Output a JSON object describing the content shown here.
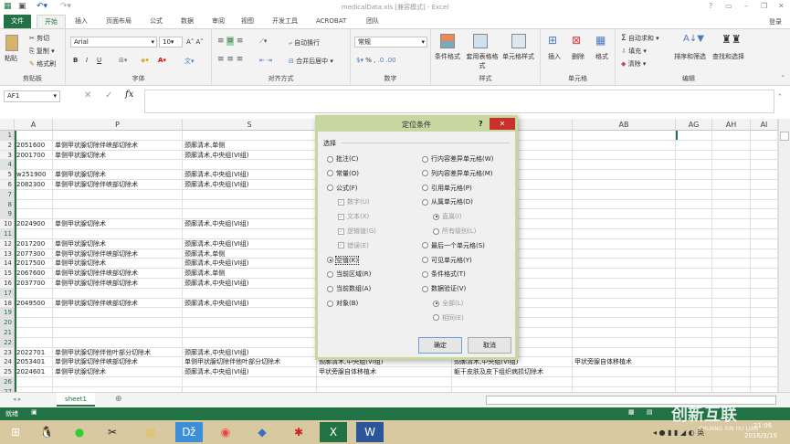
{
  "window": {
    "title": "medicalData.xls [兼容模式] - Excel",
    "help": "?",
    "login": "登录"
  },
  "tabs": [
    "文件",
    "开始",
    "插入",
    "页面布局",
    "公式",
    "数据",
    "审阅",
    "视图",
    "开发工具",
    "ACROBAT",
    "团队"
  ],
  "ribbon": {
    "clipboard": {
      "paste": "粘贴",
      "cut": "剪切",
      "copy": "复制",
      "format_painter": "格式刷",
      "label": "剪贴板"
    },
    "font": {
      "name": "Arial",
      "size": "10",
      "bold": "B",
      "italic": "I",
      "underline": "U",
      "label": "字体"
    },
    "alignment": {
      "wrap": "自动换行",
      "merge": "合并后居中",
      "label": "对齐方式"
    },
    "number": {
      "format": "常规",
      "percent": "%",
      "comma": ",",
      "label": "数字"
    },
    "styles": {
      "conditional": "条件格式",
      "table": "套用表格格式",
      "cell": "单元格样式",
      "label": "样式"
    },
    "cells": {
      "insert": "插入",
      "delete": "删除",
      "format": "格式",
      "label": "单元格"
    },
    "editing": {
      "autosum": "自动求和",
      "fill": "填充",
      "clear": "清除",
      "sort": "排序和筛选",
      "find": "查找和选择",
      "label": "编辑"
    }
  },
  "formula_bar": {
    "name_box": "AF1",
    "fx": "fx",
    "value": ""
  },
  "columns": [
    "A",
    "P",
    "S",
    "",
    "",
    "AB",
    "AG",
    "AH",
    "AI"
  ],
  "rows": [
    {
      "n": "1",
      "c": [
        "",
        "",
        "",
        "",
        "",
        ""
      ]
    },
    {
      "n": "2",
      "c": [
        "2051600",
        "单侧甲状腺切除伴峡部切除术",
        "颈廓清术,单侧",
        "",
        "",
        ""
      ]
    },
    {
      "n": "3",
      "c": [
        "2001700",
        "单侧甲状腺切除术",
        "颈廓清术,中央组(VI组)",
        "",
        "",
        ""
      ]
    },
    {
      "n": "4",
      "c": [
        "",
        "",
        "",
        "",
        "",
        ""
      ]
    },
    {
      "n": "5",
      "c": [
        "w251900",
        "单侧甲状腺切除术",
        "颈廓清术,中央组(VI组)",
        "",
        "",
        ""
      ]
    },
    {
      "n": "6",
      "c": [
        "2082300",
        "单侧甲状腺切除伴峡部切除术",
        "颈廓清术,中央组(VI组)",
        "",
        "",
        ""
      ]
    },
    {
      "n": "7",
      "c": [
        "",
        "",
        "",
        "",
        "",
        ""
      ]
    },
    {
      "n": "8",
      "c": [
        "",
        "",
        "",
        "",
        "",
        ""
      ]
    },
    {
      "n": "9",
      "c": [
        "",
        "",
        "",
        "",
        "",
        ""
      ]
    },
    {
      "n": "10",
      "c": [
        "2024900",
        "单侧甲状腺切除术",
        "颈廓清术,中央组(VI组)",
        "",
        "",
        ""
      ]
    },
    {
      "n": "11",
      "c": [
        "",
        "",
        "",
        "",
        "",
        ""
      ]
    },
    {
      "n": "12",
      "c": [
        "2017200",
        "单侧甲状腺切除术",
        "颈廓清术,中央组(VI组)",
        "",
        "",
        ""
      ]
    },
    {
      "n": "13",
      "c": [
        "2077300",
        "单侧甲状腺切除伴峡部切除术",
        "颈廓清术,单侧",
        "",
        "",
        ""
      ]
    },
    {
      "n": "14",
      "c": [
        "2017500",
        "单侧甲状腺切除术",
        "颈廓清术,中央组(VI组)",
        "",
        "",
        ""
      ]
    },
    {
      "n": "15",
      "c": [
        "2067600",
        "单侧甲状腺切除伴峡部切除术",
        "颈廓清术,单侧",
        "",
        "",
        ""
      ]
    },
    {
      "n": "16",
      "c": [
        "2037700",
        "单侧甲状腺切除伴峡部切除术",
        "颈廓清术,中央组(VI组)",
        "",
        "",
        ""
      ]
    },
    {
      "n": "17",
      "c": [
        "",
        "",
        "",
        "",
        "",
        ""
      ]
    },
    {
      "n": "18",
      "c": [
        "2049500",
        "单侧甲状腺切除伴峡部切除术",
        "颈廓清术,中央组(VI组)",
        "",
        "",
        ""
      ]
    },
    {
      "n": "19",
      "c": [
        "",
        "",
        "",
        "",
        "",
        ""
      ]
    },
    {
      "n": "20",
      "c": [
        "",
        "",
        "",
        "",
        "",
        ""
      ]
    },
    {
      "n": "21",
      "c": [
        "",
        "",
        "",
        "",
        "",
        ""
      ]
    },
    {
      "n": "22",
      "c": [
        "",
        "",
        "",
        "",
        "",
        ""
      ]
    },
    {
      "n": "23",
      "c": [
        "2022701",
        "单侧甲状腺切除伴他叶部分切除术",
        "颈廓清术,中央组(VI组)",
        "",
        "",
        ""
      ]
    },
    {
      "n": "24",
      "c": [
        "2053401",
        "单侧甲状腺切除伴峡部切除术",
        "单侧甲状腺切除伴他叶部分切除术",
        "颈廓清术,中央组(VI组)",
        "颈廓清术,中央组(VI组)",
        "甲状旁腺自体移植术"
      ]
    },
    {
      "n": "25",
      "c": [
        "2024601",
        "单侧甲状腺切除术",
        "颈廓清术,中央组(VI组)",
        "甲状旁腺自体移植术",
        "躯干皮肤及皮下组织病损切除术",
        ""
      ]
    },
    {
      "n": "26",
      "c": [
        "",
        "",
        "",
        "",
        "",
        ""
      ]
    },
    {
      "n": "27",
      "c": [
        "",
        "",
        "",
        "",
        "",
        ""
      ]
    }
  ],
  "blank_rows": [
    "1",
    "4",
    "7",
    "8",
    "9",
    "11",
    "17",
    "19",
    "20",
    "21",
    "22",
    "26",
    "27"
  ],
  "sheet_tab": "sheet1",
  "status": {
    "ready": "就绪"
  },
  "clock": {
    "time": "21:06",
    "date": "2016/3/19"
  },
  "watermark": {
    "name": "创新互联",
    "sub": "CHUANG XIN HU LIAN"
  },
  "dialog": {
    "title": "定位条件",
    "help": "?",
    "section": "选择",
    "left": [
      {
        "label": "批注(C)",
        "type": "radio",
        "on": false,
        "dis": false
      },
      {
        "label": "常量(O)",
        "type": "radio",
        "on": false,
        "dis": false
      },
      {
        "label": "公式(F)",
        "type": "radio",
        "on": false,
        "dis": false
      },
      {
        "label": "数字(U)",
        "type": "check",
        "on": true,
        "dis": true
      },
      {
        "label": "文本(X)",
        "type": "check",
        "on": true,
        "dis": true
      },
      {
        "label": "逻辑值(G)",
        "type": "check",
        "on": true,
        "dis": true
      },
      {
        "label": "错误(E)",
        "type": "check",
        "on": true,
        "dis": true
      },
      {
        "label": "空值(K)",
        "type": "radio",
        "on": true,
        "dis": false
      },
      {
        "label": "当前区域(R)",
        "type": "radio",
        "on": false,
        "dis": false
      },
      {
        "label": "当前数组(A)",
        "type": "radio",
        "on": false,
        "dis": false
      },
      {
        "label": "对象(B)",
        "type": "radio",
        "on": false,
        "dis": false
      }
    ],
    "right": [
      {
        "label": "行内容差异单元格(W)",
        "type": "radio",
        "on": false,
        "dis": false
      },
      {
        "label": "列内容差异单元格(M)",
        "type": "radio",
        "on": false,
        "dis": false
      },
      {
        "label": "引用单元格(P)",
        "type": "radio",
        "on": false,
        "dis": false
      },
      {
        "label": "从属单元格(D)",
        "type": "radio",
        "on": false,
        "dis": false
      },
      {
        "label": "直属(I)",
        "type": "radio",
        "on": true,
        "dis": true
      },
      {
        "label": "所有级别(L)",
        "type": "radio",
        "on": false,
        "dis": true
      },
      {
        "label": "最后一个单元格(S)",
        "type": "radio",
        "on": false,
        "dis": false
      },
      {
        "label": "可见单元格(Y)",
        "type": "radio",
        "on": false,
        "dis": false
      },
      {
        "label": "条件格式(T)",
        "type": "radio",
        "on": false,
        "dis": false
      },
      {
        "label": "数据验证(V)",
        "type": "radio",
        "on": false,
        "dis": false
      },
      {
        "label": "全部(L)",
        "type": "radio",
        "on": true,
        "dis": true
      },
      {
        "label": "相同(E)",
        "type": "radio",
        "on": false,
        "dis": true
      }
    ],
    "ok": "确定",
    "cancel": "取消"
  }
}
